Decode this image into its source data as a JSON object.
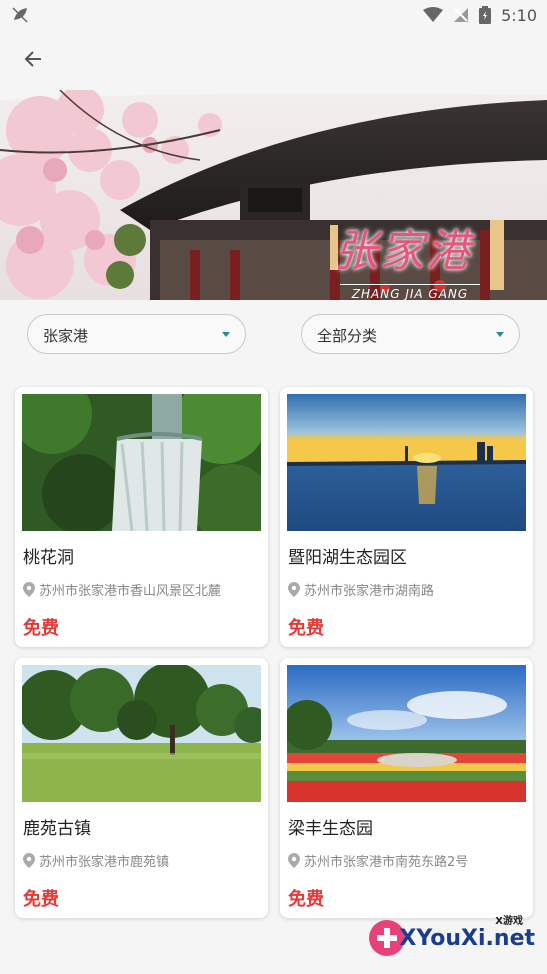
{
  "status_bar": {
    "time": "5:10"
  },
  "banner": {
    "title": "张家港",
    "subtitle": "ZHANG JIA GANG"
  },
  "filters": {
    "city": "张家港",
    "category": "全部分类"
  },
  "cards": [
    {
      "name": "桃花洞",
      "address": "苏州市张家港市香山风景区北麓",
      "price": "免费"
    },
    {
      "name": "暨阳湖生态园区",
      "address": "苏州市张家港市湖南路",
      "price": "免费"
    },
    {
      "name": "鹿苑古镇",
      "address": "苏州市张家港市鹿苑镇",
      "price": "免费"
    },
    {
      "name": "梁丰生态园",
      "address": "苏州市张家港市南苑东路2号",
      "price": "免费"
    }
  ],
  "watermark": {
    "top": "X游戏",
    "main": "XYouXi.net"
  },
  "colors": {
    "accent": "#2a8c87",
    "price": "#e53935",
    "banner_title": "#e4557f"
  }
}
